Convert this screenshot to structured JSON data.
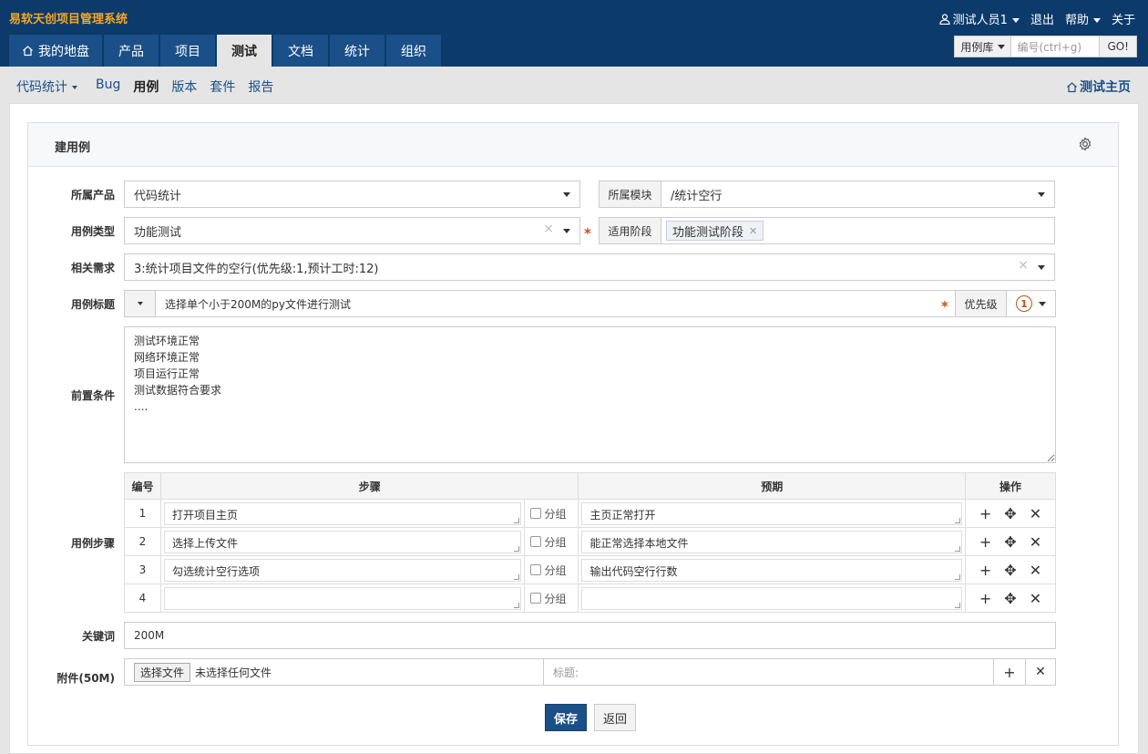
{
  "app": {
    "title": "易软天创项目管理系统"
  },
  "user": {
    "name": "测试人员1",
    "logout": "退出",
    "help": "帮助",
    "about": "关于"
  },
  "nav": {
    "tabs": [
      "我的地盘",
      "产品",
      "项目",
      "测试",
      "文档",
      "统计",
      "组织"
    ],
    "active": "测试"
  },
  "search": {
    "type": "用例库",
    "placeholder": "编号(ctrl+g)",
    "go": "GO!"
  },
  "subnav": {
    "product": "代码统计",
    "items": [
      "Bug",
      "用例",
      "版本",
      "套件",
      "报告"
    ],
    "current": "用例",
    "home": "测试主页"
  },
  "panel": {
    "title": "建用例"
  },
  "form": {
    "product_label": "所属产品",
    "product_value": "代码统计",
    "module_label": "所属模块",
    "module_value": "/统计空行",
    "type_label": "用例类型",
    "type_value": "功能测试",
    "stage_label": "适用阶段",
    "stage_value": "功能测试阶段",
    "story_label": "相关需求",
    "story_value": "3:统计项目文件的空行(优先级:1,预计工时:12)",
    "title_label": "用例标题",
    "title_value": "选择单个小于200M的py文件进行测试",
    "priority_label": "优先级",
    "priority_value": "1",
    "precondition_label": "前置条件",
    "precondition_value": "测试环境正常\n网络环境正常\n项目运行正常\n测试数据符合要求\n....",
    "steps_label": "用例步骤",
    "keywords_label": "关键词",
    "keywords_value": "200M",
    "files_label": "附件(50M)",
    "file_button": "选择文件",
    "file_status": "未选择任何文件",
    "file_title_placeholder": "标题:",
    "save": "保存",
    "back": "返回"
  },
  "steps": {
    "headers": {
      "no": "编号",
      "step": "步骤",
      "expect": "预期",
      "ops": "操作"
    },
    "group_label": "分组",
    "rows": [
      {
        "no": "1",
        "step": "打开项目主页",
        "expect": "主页正常打开"
      },
      {
        "no": "2",
        "step": "选择上传文件",
        "expect": "能正常选择本地文件"
      },
      {
        "no": "3",
        "step": "勾选统计空行选项",
        "expect": "输出代码空行行数"
      },
      {
        "no": "4",
        "step": "",
        "expect": ""
      }
    ]
  },
  "colors": {
    "topbar": "#0c3a6a",
    "brand": "#f5a623",
    "primary": "#1a4f87",
    "required": "#c0531f"
  }
}
